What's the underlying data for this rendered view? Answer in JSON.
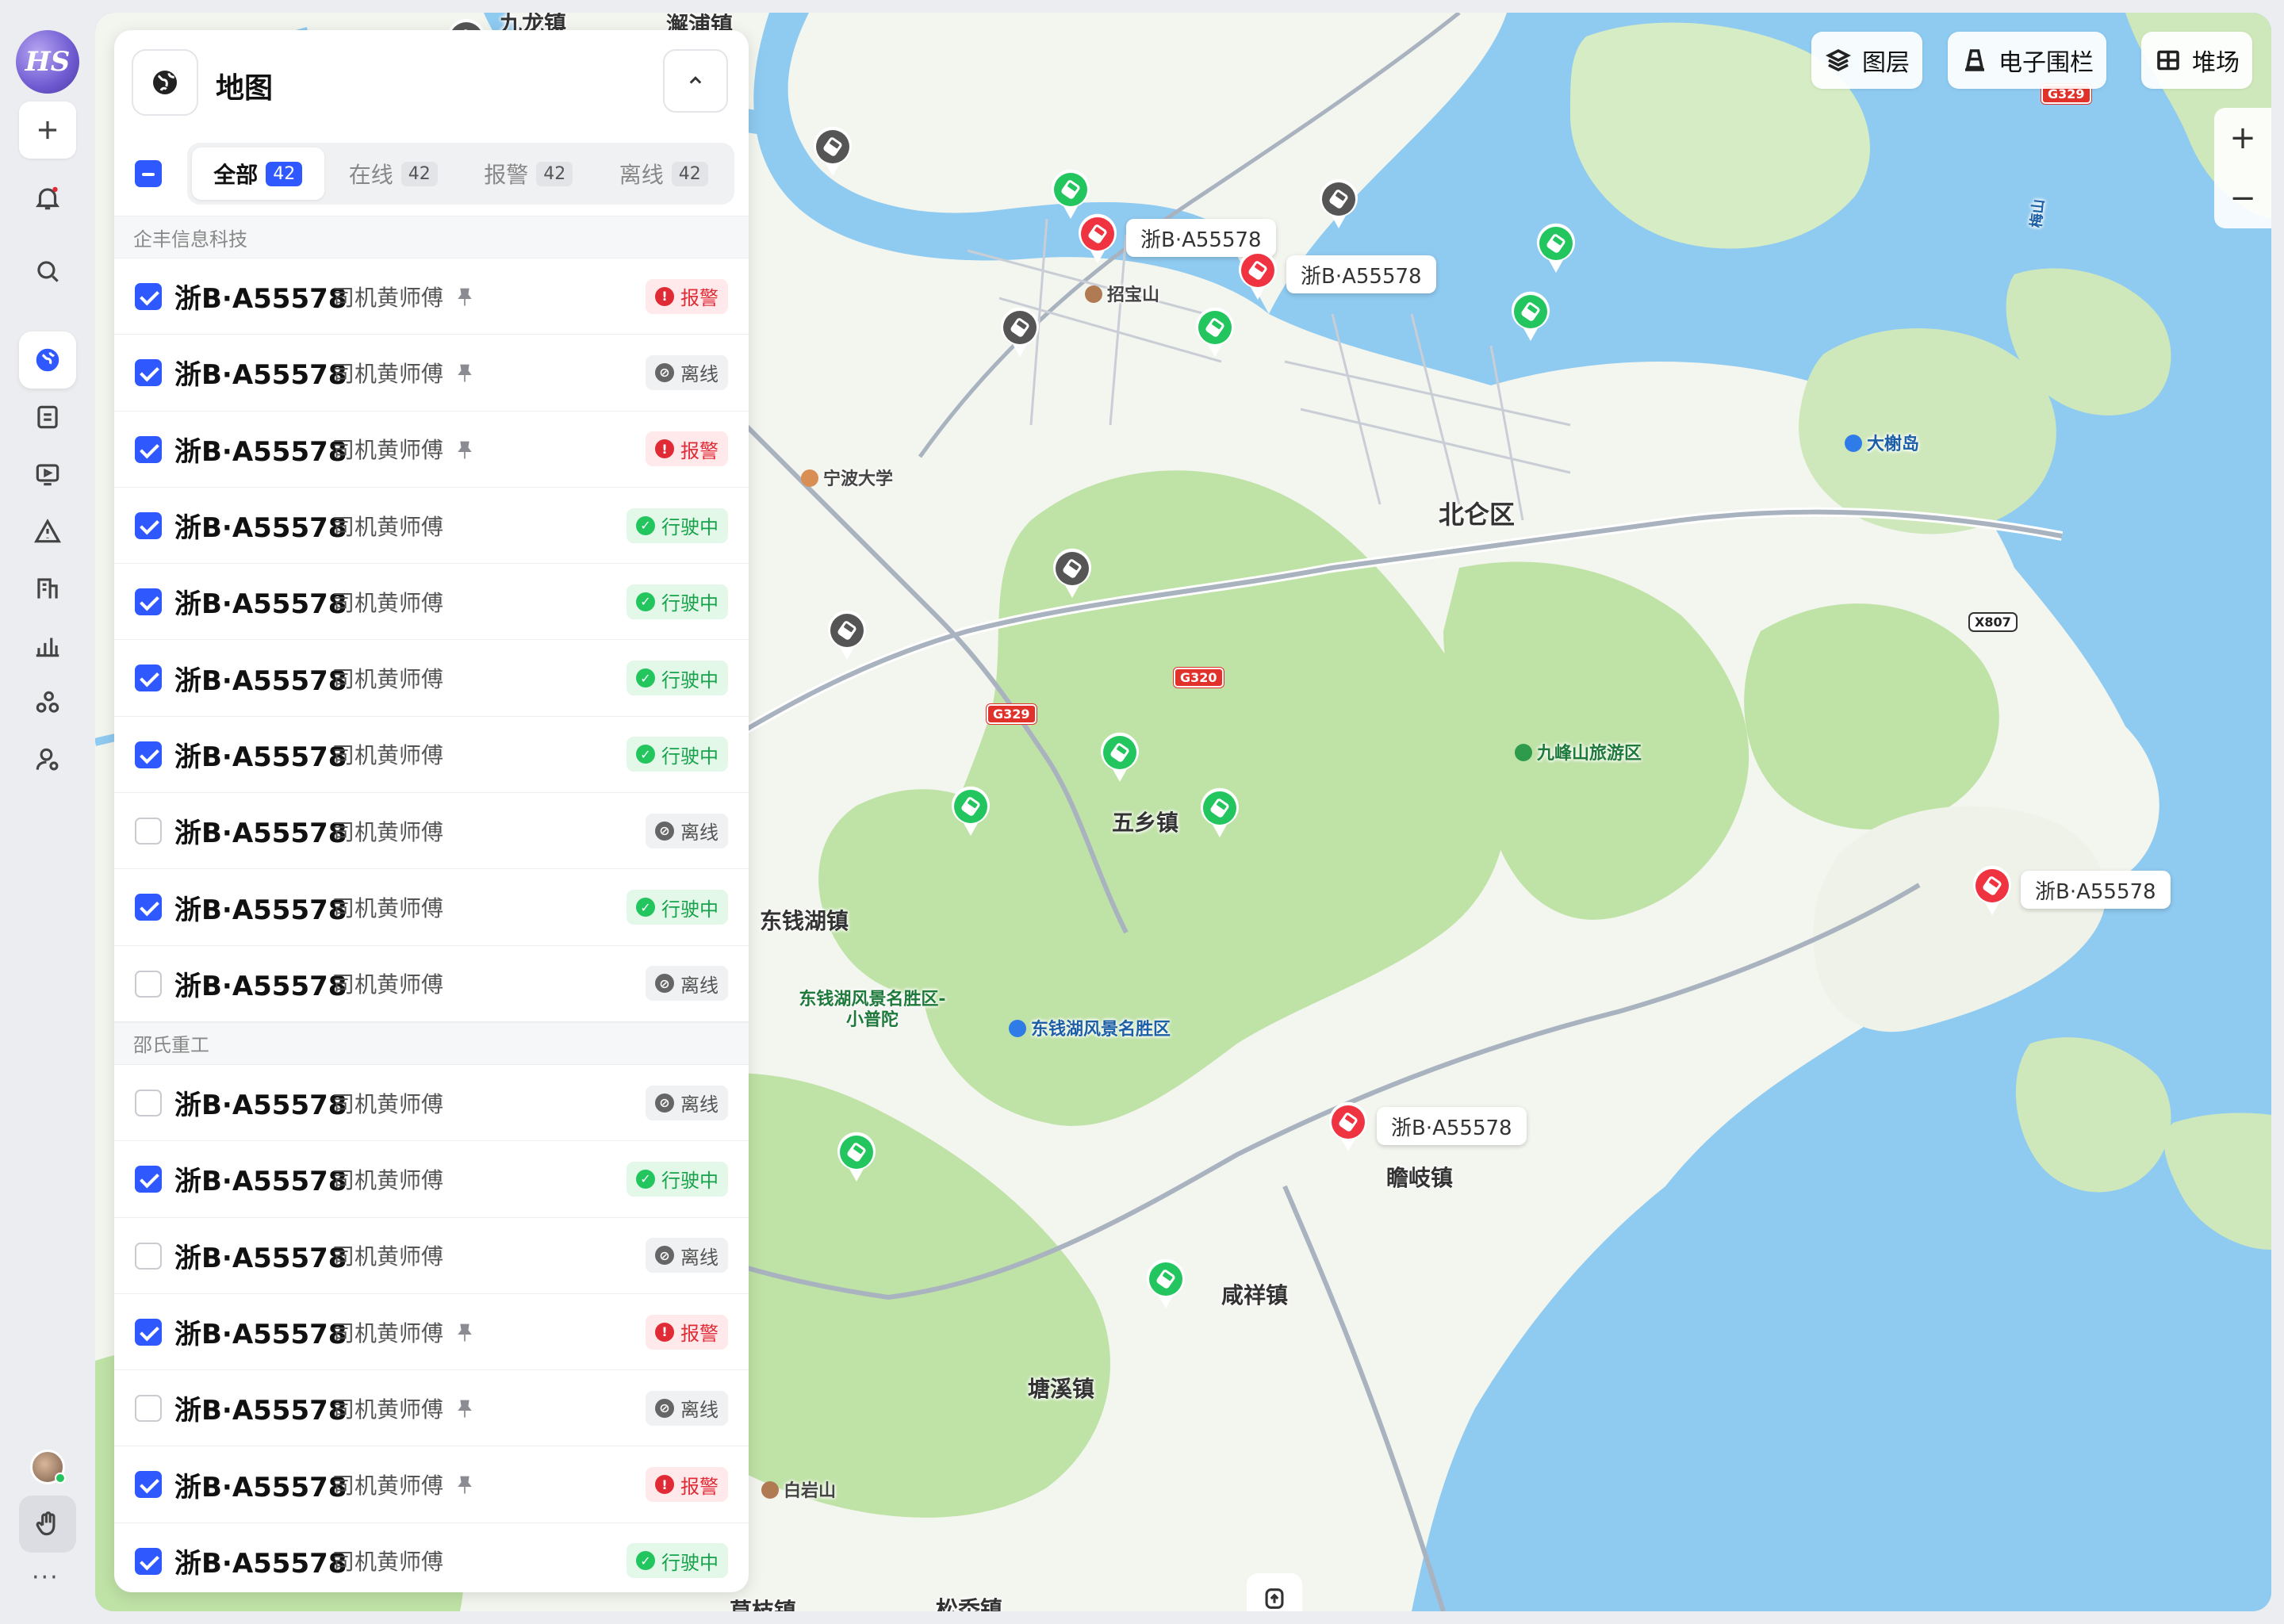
{
  "app": {
    "logo_text": "HS"
  },
  "rail": {
    "items": [
      "add",
      "alerts",
      "search",
      "map",
      "orders",
      "monitor",
      "warnings",
      "vehicles",
      "reports",
      "fleet",
      "users"
    ],
    "active": "map"
  },
  "panel": {
    "title": "地图",
    "tabs": [
      {
        "label": "全部",
        "count": "42"
      },
      {
        "label": "在线",
        "count": "42"
      },
      {
        "label": "报警",
        "count": "42"
      },
      {
        "label": "离线",
        "count": "42"
      }
    ],
    "groups": [
      {
        "name": "企丰信息科技",
        "rows": [
          {
            "plate": "浙B·A55578",
            "driver": "司机黄师傅",
            "pinned": true,
            "checked": true,
            "status": "报警",
            "kind": "alarm"
          },
          {
            "plate": "浙B·A55578",
            "driver": "司机黄师傅",
            "pinned": true,
            "checked": true,
            "status": "离线",
            "kind": "off"
          },
          {
            "plate": "浙B·A55578",
            "driver": "司机黄师傅",
            "pinned": true,
            "checked": true,
            "status": "报警",
            "kind": "alarm"
          },
          {
            "plate": "浙B·A55578",
            "driver": "司机黄师傅",
            "pinned": false,
            "checked": true,
            "status": "行驶中",
            "kind": "run"
          },
          {
            "plate": "浙B·A55578",
            "driver": "司机黄师傅",
            "pinned": false,
            "checked": true,
            "status": "行驶中",
            "kind": "run"
          },
          {
            "plate": "浙B·A55578",
            "driver": "司机黄师傅",
            "pinned": false,
            "checked": true,
            "status": "行驶中",
            "kind": "run"
          },
          {
            "plate": "浙B·A55578",
            "driver": "司机黄师傅",
            "pinned": false,
            "checked": true,
            "status": "行驶中",
            "kind": "run"
          },
          {
            "plate": "浙B·A55578",
            "driver": "司机黄师傅",
            "pinned": false,
            "checked": false,
            "status": "离线",
            "kind": "off"
          },
          {
            "plate": "浙B·A55578",
            "driver": "司机黄师傅",
            "pinned": false,
            "checked": true,
            "status": "行驶中",
            "kind": "run"
          },
          {
            "plate": "浙B·A55578",
            "driver": "司机黄师傅",
            "pinned": false,
            "checked": false,
            "status": "离线",
            "kind": "off"
          }
        ]
      },
      {
        "name": "邵氏重工",
        "rows": [
          {
            "plate": "浙B·A55578",
            "driver": "司机黄师傅",
            "pinned": false,
            "checked": false,
            "status": "离线",
            "kind": "off"
          },
          {
            "plate": "浙B·A55578",
            "driver": "司机黄师傅",
            "pinned": false,
            "checked": true,
            "status": "行驶中",
            "kind": "run"
          },
          {
            "plate": "浙B·A55578",
            "driver": "司机黄师傅",
            "pinned": false,
            "checked": false,
            "status": "离线",
            "kind": "off"
          },
          {
            "plate": "浙B·A55578",
            "driver": "司机黄师傅",
            "pinned": true,
            "checked": true,
            "status": "报警",
            "kind": "alarm"
          },
          {
            "plate": "浙B·A55578",
            "driver": "司机黄师傅",
            "pinned": true,
            "checked": false,
            "status": "离线",
            "kind": "off"
          },
          {
            "plate": "浙B·A55578",
            "driver": "司机黄师傅",
            "pinned": true,
            "checked": true,
            "status": "报警",
            "kind": "alarm"
          },
          {
            "plate": "浙B·A55578",
            "driver": "司机黄师傅",
            "pinned": false,
            "checked": true,
            "status": "行驶中",
            "kind": "run"
          }
        ]
      }
    ]
  },
  "toolbar": {
    "layers": "图层",
    "fence": "电子围栏",
    "yard": "堆场",
    "zoom_in": "+",
    "zoom_out": "−"
  },
  "map": {
    "places": [
      {
        "text": "九龙镇",
        "cls": ""
      },
      {
        "text": "澥浦镇",
        "cls": ""
      },
      {
        "text": "北仑区",
        "cls": "big"
      },
      {
        "text": "大榭岛",
        "cls": "poi"
      },
      {
        "text": "招宝山",
        "cls": "brn"
      },
      {
        "text": "宁波大学",
        "cls": "brn"
      },
      {
        "text": "九峰山旅游区",
        "cls": "grn"
      },
      {
        "text": "东钱湖镇",
        "cls": ""
      },
      {
        "text": "东钱湖风景名胜区-小普陀",
        "cls": "grn"
      },
      {
        "text": "东钱湖风景名胜区",
        "cls": "poi"
      },
      {
        "text": "瞻岐镇",
        "cls": ""
      },
      {
        "text": "咸祥镇",
        "cls": ""
      },
      {
        "text": "塘溪镇",
        "cls": ""
      },
      {
        "text": "白岩山",
        "cls": "brn"
      },
      {
        "text": "梅山",
        "cls": "poi"
      },
      {
        "text": "五乡镇",
        "cls": ""
      },
      {
        "text": "松岙镇",
        "cls": ""
      },
      {
        "text": "莫枝镇",
        "cls": ""
      }
    ],
    "shields": [
      "G329",
      "G329",
      "G320",
      "X807"
    ],
    "vehicle_tag": "浙B·A55578",
    "colors": {
      "online": "#22c55e",
      "alarm": "#ef3340",
      "offline": "#555555",
      "water": "#8fcaf0",
      "land": "#f3f5ef",
      "forest": "#bfe2a6"
    }
  }
}
